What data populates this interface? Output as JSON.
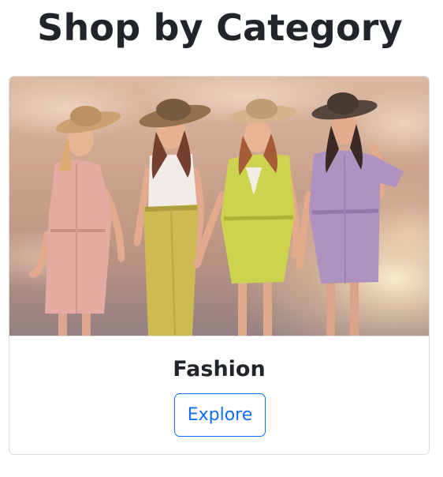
{
  "page": {
    "title": "Shop by Category"
  },
  "card": {
    "image_subject": "four women in sun hats and pastel outfits walking against a sunset sky",
    "title": "Fashion",
    "button_label": "Explore"
  },
  "colors": {
    "text": "#212529",
    "accent": "#0d6efd",
    "card_border": "#dcdcdc"
  }
}
